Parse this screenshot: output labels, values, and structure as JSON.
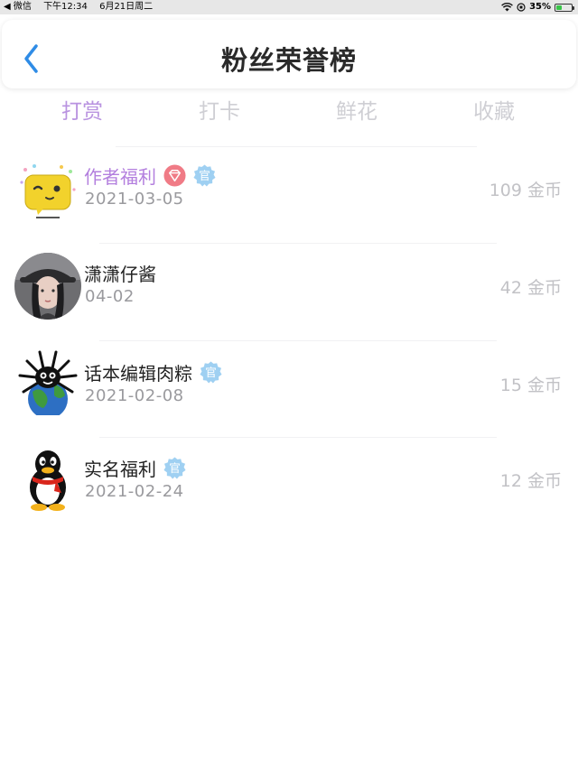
{
  "status_bar": {
    "back_app": "◀ 微信",
    "time": "下午12:34",
    "date": "6月21日周二",
    "battery_pct": "35%",
    "battery_level": 0.35
  },
  "nav": {
    "title": "粉丝荣誉榜"
  },
  "tabs": [
    {
      "label": "打赏",
      "active": true
    },
    {
      "label": "打卡",
      "active": false
    },
    {
      "label": "鲜花",
      "active": false
    },
    {
      "label": "收藏",
      "active": false
    }
  ],
  "ranking": [
    {
      "name": "作者福利",
      "date": "2021-03-05",
      "coins": "109 金币",
      "vip_badge": true,
      "official_badge": true,
      "badge_text": "官",
      "avatar": "yellow-wink-emoji"
    },
    {
      "name": "潇潇仔酱",
      "date": "04-02",
      "coins": "42 金币",
      "vip_badge": false,
      "official_badge": false,
      "avatar": "photo-girl-with-hat"
    },
    {
      "name": "话本编辑肉粽",
      "date": "2021-02-08",
      "coins": "15 金币",
      "vip_badge": false,
      "official_badge": true,
      "badge_text": "官",
      "avatar": "spider-earth-sticker"
    },
    {
      "name": "实名福利",
      "date": "2021-02-24",
      "coins": "12 金币",
      "vip_badge": false,
      "official_badge": true,
      "badge_text": "官",
      "avatar": "qq-penguin"
    }
  ],
  "colors": {
    "accent": "#b993e0",
    "vip_name": "#b37fde",
    "back_arrow": "#2f8ce6",
    "official_badge": "#9fd0f2",
    "vip_badge": "#f07b86"
  }
}
